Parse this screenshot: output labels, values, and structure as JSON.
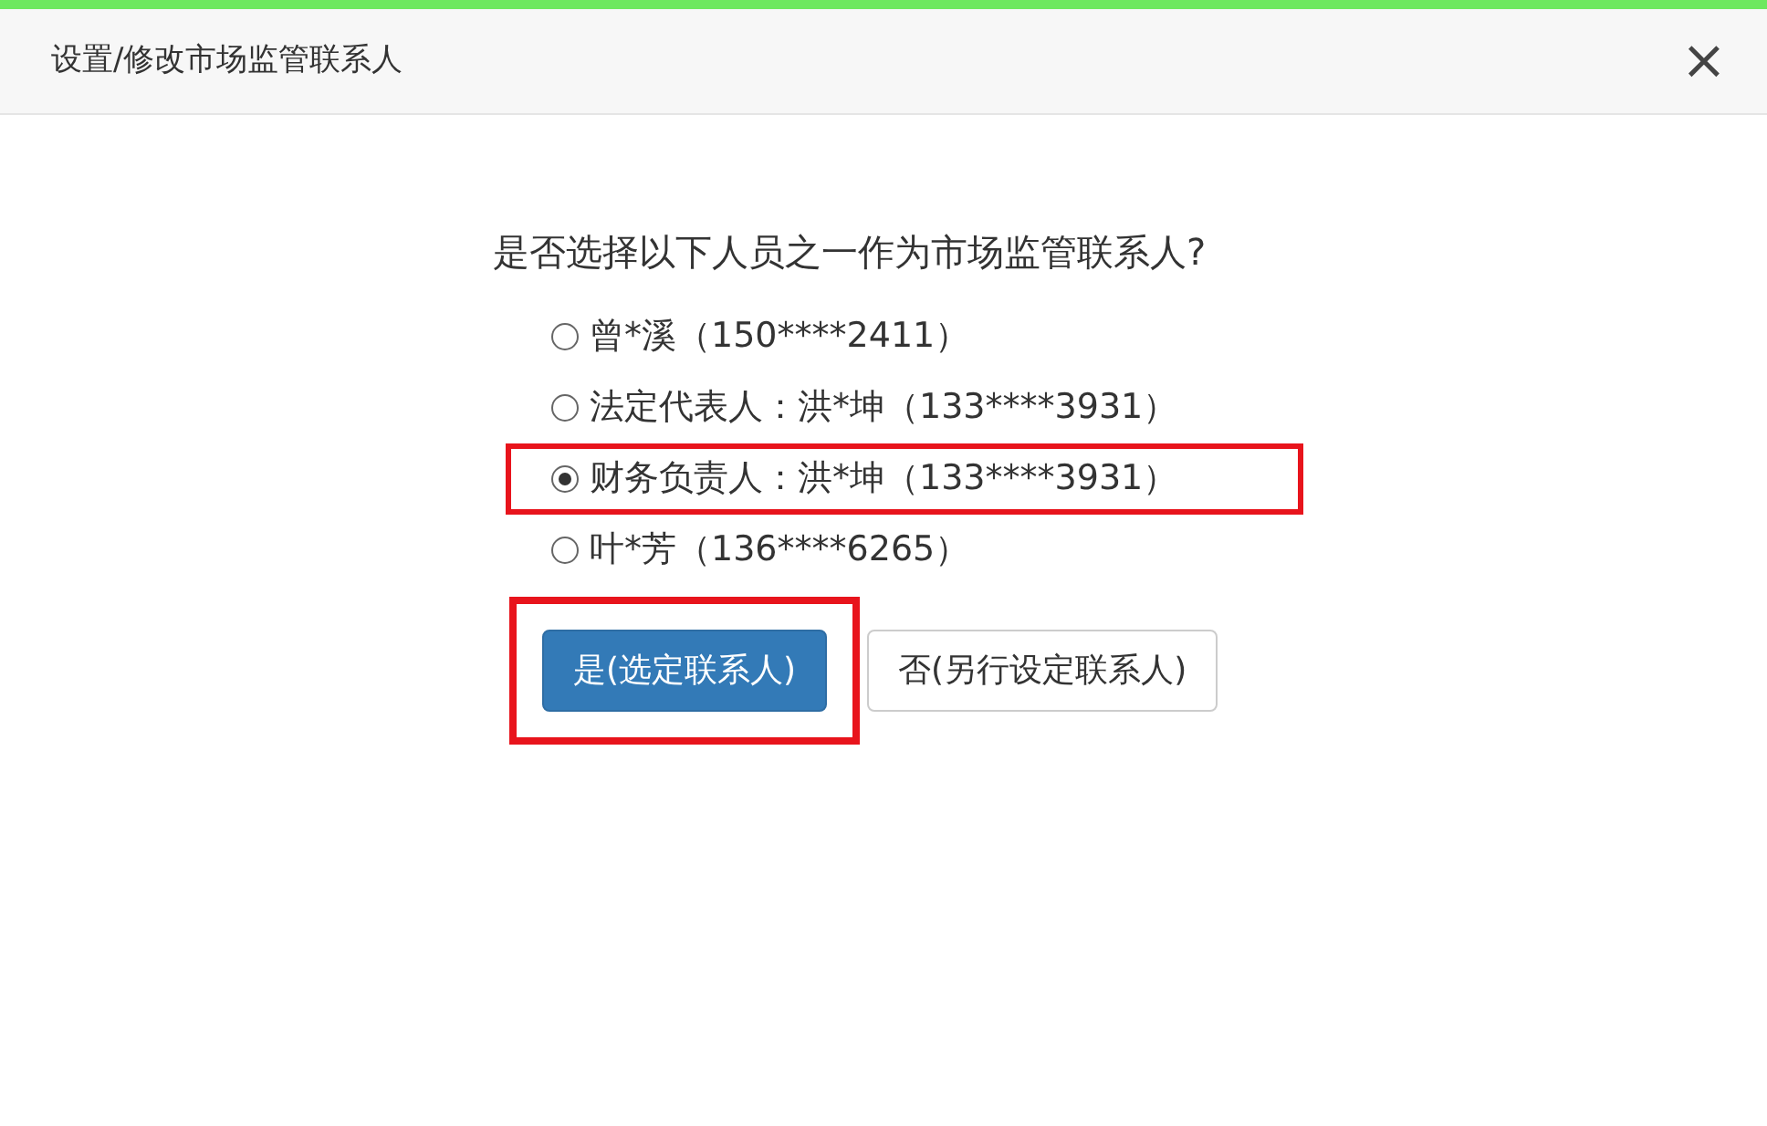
{
  "dialog": {
    "title": "设置/修改市场监管联系人",
    "close": "×"
  },
  "question": "是否选择以下人员之一作为市场监管联系人?",
  "options": [
    {
      "label": "曾*溪（150****2411）",
      "selected": false,
      "highlighted": false
    },
    {
      "label": "法定代表人：洪*坤（133****3931）",
      "selected": false,
      "highlighted": false
    },
    {
      "label": "财务负责人：洪*坤（133****3931）",
      "selected": true,
      "highlighted": true
    },
    {
      "label": "叶*芳（136****6265）",
      "selected": false,
      "highlighted": false
    }
  ],
  "buttons": [
    {
      "label": "是(选定联系人)",
      "kind": "primary",
      "highlighted": true
    },
    {
      "label": "否(另行设定联系人)",
      "kind": "default",
      "highlighted": false
    }
  ]
}
